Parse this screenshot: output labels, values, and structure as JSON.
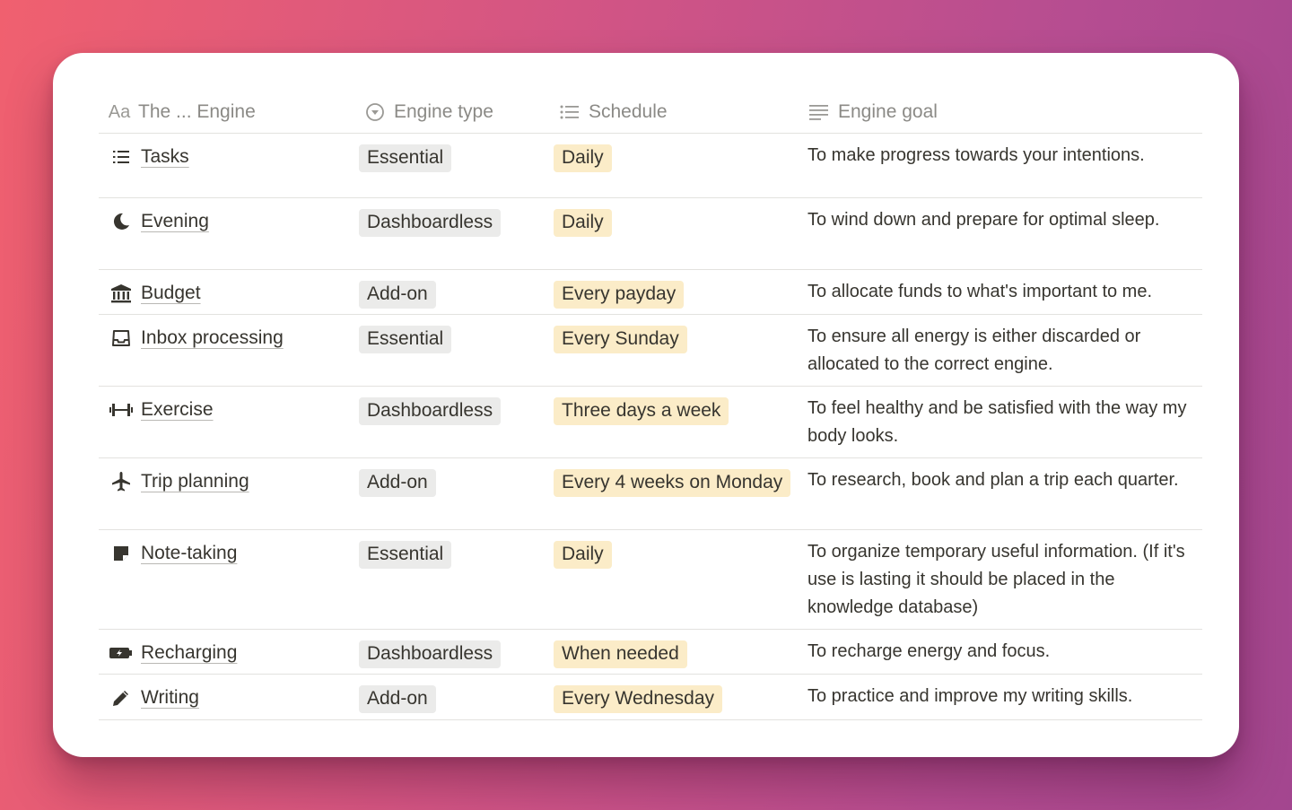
{
  "columns": [
    {
      "icon": "text-aa-icon",
      "label": "The ... Engine"
    },
    {
      "icon": "select-icon",
      "label": "Engine type"
    },
    {
      "icon": "multi-select-list-icon",
      "label": "Schedule"
    },
    {
      "icon": "text-lines-icon",
      "label": "Engine goal"
    }
  ],
  "header_icon_text": "Aa",
  "rows": [
    {
      "icon": "list-icon",
      "name": "Tasks",
      "type": "Essential",
      "schedule": "Daily",
      "goal": "To make progress towards your intentions."
    },
    {
      "icon": "moon-icon",
      "name": "Evening",
      "type": "Dashboardless",
      "schedule": "Daily",
      "goal": "To wind down and prepare for optimal sleep."
    },
    {
      "icon": "bank-icon",
      "name": "Budget",
      "type": "Add-on",
      "schedule": "Every payday",
      "goal": "To allocate funds to what's important to me."
    },
    {
      "icon": "inbox-tray-icon",
      "name": "Inbox processing",
      "type": "Essential",
      "schedule": "Every Sunday",
      "goal": "To ensure all energy is either discarded or allocated to the correct engine."
    },
    {
      "icon": "dumbbell-icon",
      "name": "Exercise",
      "type": "Dashboardless",
      "schedule": "Three days a week",
      "goal": "To feel healthy and be satisfied with the way my body looks."
    },
    {
      "icon": "airplane-icon",
      "name": "Trip planning",
      "type": "Add-on",
      "schedule": "Every 4 weeks on Monday",
      "goal": "To research, book and plan a trip each quarter."
    },
    {
      "icon": "sticky-note-icon",
      "name": "Note-taking",
      "type": "Essential",
      "schedule": "Daily",
      "goal": "To organize temporary useful information. (If it's use is lasting it should be placed in the knowledge database)"
    },
    {
      "icon": "battery-charging-icon",
      "name": "Recharging",
      "type": "Dashboardless",
      "schedule": "When needed",
      "goal": "To recharge energy and focus."
    },
    {
      "icon": "pencil-icon",
      "name": "Writing",
      "type": "Add-on",
      "schedule": "Every Wednesday",
      "goal": "To practice and improve my writing skills."
    }
  ],
  "tag_colors": {
    "type": "#ebebea",
    "schedule": "#fbecc8"
  }
}
